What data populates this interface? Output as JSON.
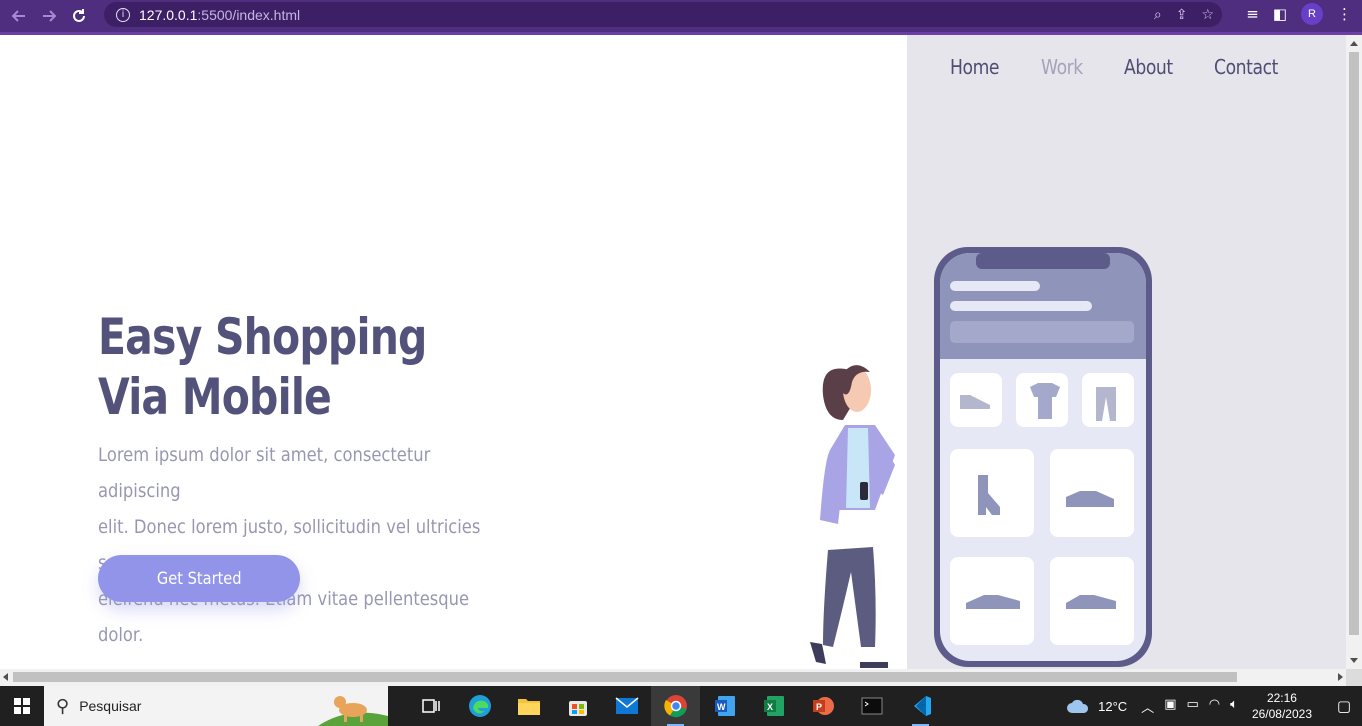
{
  "browser": {
    "url_host": "127.0.0.1",
    "url_path": ":5500/index.html",
    "profile_initial": "R"
  },
  "nav": {
    "items": [
      "Home",
      "Work",
      "About",
      "Contact"
    ]
  },
  "hero": {
    "title_line1": "Easy Shopping",
    "title_line2": "Via Mobile",
    "lead_line1": "Lorem ipsum dolor sit amet, consectetur adipiscing",
    "lead_line2": "elit. Donec lorem justo, sollicitudin vel ultricies sed,",
    "lead_line3": "eleifend nec metus. Etiam vitae pellentesque dolor.",
    "cta_label": "Get Started"
  },
  "colors": {
    "browser_chrome": "#4f2d7f",
    "heading": "#53527a",
    "accent_button": "#9194e8",
    "panel_bg": "#e6e5ec"
  },
  "taskbar": {
    "search_placeholder": "Pesquisar",
    "weather": "12°C",
    "time": "22:16",
    "date": "26/08/2023",
    "apps": [
      "task-view-icon",
      "edge-icon",
      "file-explorer-icon",
      "store-icon",
      "mail-icon",
      "chrome-icon",
      "word-icon",
      "excel-icon",
      "powerpoint-icon",
      "terminal-icon",
      "vscode-icon"
    ]
  }
}
